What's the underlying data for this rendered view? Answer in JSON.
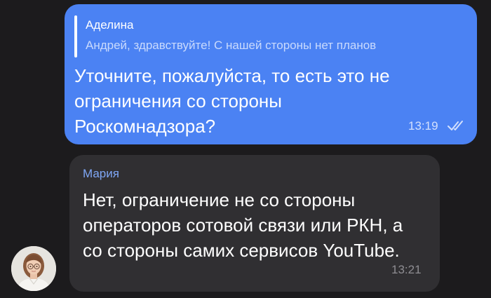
{
  "outgoing": {
    "reply": {
      "author": "Аделина",
      "text": "Андрей, здравствуйте! С нашей стороны нет планов"
    },
    "text": "Уточните, пожалуйста, то есть это не ограничения со стороны Роскомнадзора?",
    "time": "13:19",
    "status_icon": "double-check-icon"
  },
  "incoming": {
    "author": "Мария",
    "text": "Нет, ограничение не со стороны операторов сотовой связи или РКН, а со стороны самих сервисов YouTube.",
    "time": "13:21",
    "avatar_icon": "user-avatar"
  },
  "colors": {
    "background": "#1c1b1d",
    "outgoing_bubble": "#4b82f3",
    "incoming_bubble": "#302f32",
    "author_name": "#7fa7f6"
  }
}
